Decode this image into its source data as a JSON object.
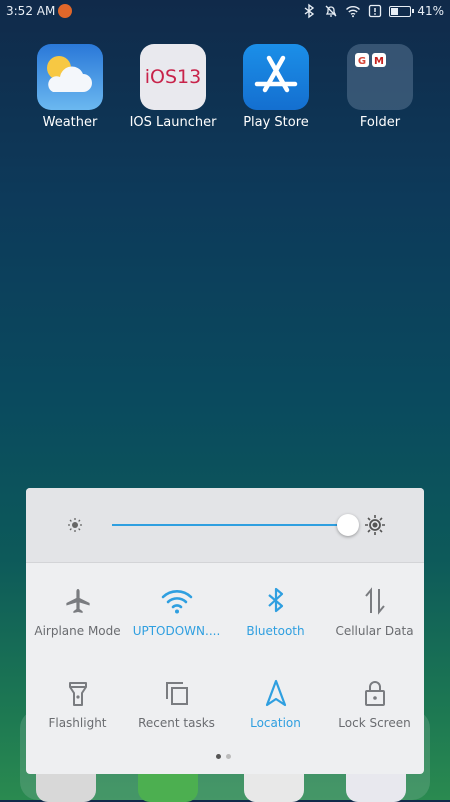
{
  "status_bar": {
    "time": "3:52 AM",
    "battery_percent": "41%",
    "battery_level": 0.41,
    "icons": [
      "bluetooth-icon",
      "bell-muted-icon",
      "wifi-icon",
      "alert-icon",
      "battery-icon"
    ]
  },
  "home_apps": [
    {
      "label": "Weather",
      "icon": "weather-icon"
    },
    {
      "label": "IOS Launcher",
      "icon_text": "iOS13"
    },
    {
      "label": "Play Store",
      "icon": "app-store-icon"
    },
    {
      "label": "Folder",
      "icon": "folder-icon"
    }
  ],
  "control_panel": {
    "brightness_level": 1.0,
    "accent_color": "#2f9fe0",
    "inactive_color": "#7a7c80",
    "toggles": [
      {
        "label": "Airplane Mode",
        "icon": "airplane-icon",
        "active": false
      },
      {
        "label": "UPTODOWN....",
        "icon": "wifi-icon",
        "active": true
      },
      {
        "label": "Bluetooth",
        "icon": "bluetooth-icon",
        "active": true
      },
      {
        "label": "Cellular Data",
        "icon": "cellular-data-icon",
        "active": false
      },
      {
        "label": "Flashlight",
        "icon": "flashlight-icon",
        "active": false
      },
      {
        "label": "Recent tasks",
        "icon": "recent-tasks-icon",
        "active": false
      },
      {
        "label": "Location",
        "icon": "location-icon",
        "active": true
      },
      {
        "label": "Lock Screen",
        "icon": "lock-icon",
        "active": false
      }
    ],
    "page_count": 2,
    "current_page": 1
  }
}
